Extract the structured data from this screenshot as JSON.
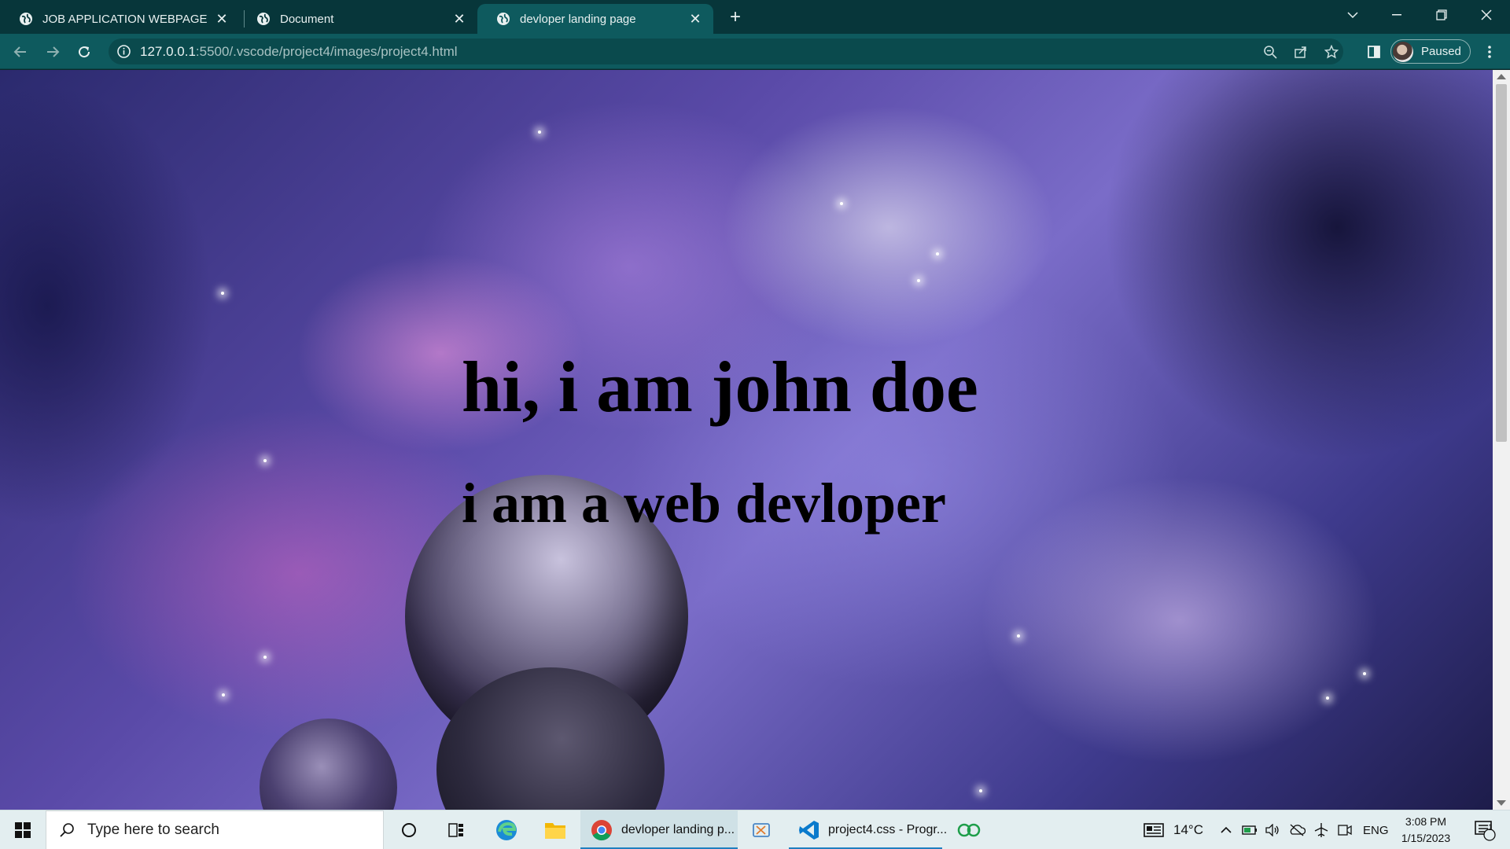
{
  "browser": {
    "tabs": [
      {
        "title": "JOB APPLICATION WEBPAGE",
        "active": false
      },
      {
        "title": "Document",
        "active": false
      },
      {
        "title": "devloper landing page",
        "active": true
      }
    ],
    "url_host": "127.0.0.1",
    "url_rest": ":5500/.vscode/project4/images/project4.html",
    "profile_label": "Paused"
  },
  "page": {
    "heading": "hi, i am john doe",
    "subheading": "i am a web devloper"
  },
  "taskbar": {
    "search_placeholder": "Type here to search",
    "apps": [
      {
        "label": "devloper landing p..."
      },
      {
        "label": "project4.css - Progr..."
      }
    ],
    "weather": "14°C",
    "language": "ENG",
    "time": "3:08 PM",
    "date": "1/15/2023",
    "notification_count": "1"
  },
  "colors": {
    "chrome_bg": "#07363a",
    "toolbar_bg": "#0e5a5e",
    "hero_text": "#000000",
    "taskbar_bg": "#e3eef0"
  }
}
